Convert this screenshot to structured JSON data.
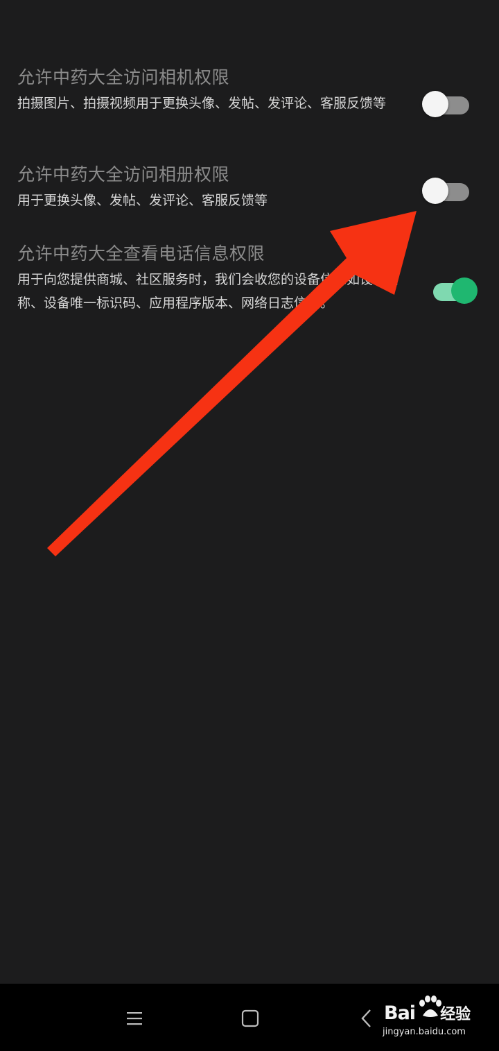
{
  "permissions": [
    {
      "title": "允许中药大全访问相机权限",
      "description": "拍摄图片、拍摄视频用于更换头像、发帖、发评论、客服反馈等",
      "enabled": false
    },
    {
      "title": "允许中药大全访问相册权限",
      "description": "用于更换头像、发帖、发评论、客服反馈等",
      "enabled": false
    },
    {
      "title": "允许中药大全查看电话信息权限",
      "description": "用于向您提供商城、社区服务时，我们会收您的设备信息如设备名称、设备唯一标识码、应用程序版本、网络日志信息。",
      "enabled": true
    }
  ],
  "colors": {
    "background": "#1c1c1d",
    "title_text": "#8c8c8c",
    "desc_text": "#d6d6d6",
    "toggle_on_track": "#7fd9b0",
    "toggle_on_knob": "#1fb770",
    "toggle_off_track": "#8d8d8d",
    "toggle_off_knob": "#f4f4f4",
    "annotation_arrow": "#f63213",
    "navbar": "#000000"
  },
  "annotation": {
    "type": "arrow",
    "points_to": "album-permission-toggle"
  },
  "navbar": {
    "menu_icon": "menu-icon",
    "home_icon": "home-square-icon",
    "back_icon": "back-chevron-icon"
  },
  "watermark": {
    "logo_text": "Bai",
    "logo_suffix": "经验",
    "url": "jingyan.baidu.com"
  }
}
